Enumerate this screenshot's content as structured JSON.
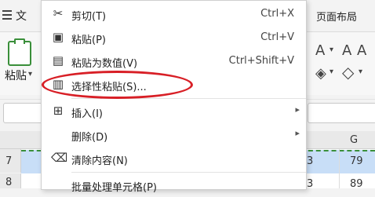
{
  "menubar": {
    "file_label": "文",
    "layout_tab": "页面布局"
  },
  "ribbon": {
    "paste_label": "粘贴",
    "paste_arrow": "▾"
  },
  "grid": {
    "col_g": "G",
    "rows": [
      {
        "num": "7",
        "f": "3",
        "g": "79"
      },
      {
        "num": "8",
        "f": "3",
        "g": "89"
      }
    ]
  },
  "context_menu": {
    "items": [
      {
        "icon": "scissors-icon",
        "label": "剪切(T)",
        "shortcut": "Ctrl+X"
      },
      {
        "icon": "clipboard-icon",
        "label": "粘贴(P)",
        "shortcut": "Ctrl+V"
      },
      {
        "icon": "paste-values-icon",
        "label": "粘贴为数值(V)",
        "shortcut": "Ctrl+Shift+V"
      },
      {
        "icon": "paste-special-icon",
        "label": "选择性粘贴(S)..."
      },
      {
        "icon": "insert-icon",
        "label": "插入(I)",
        "submenu": "▸"
      },
      {
        "icon": "",
        "label": "删除(D)",
        "submenu": "▸"
      },
      {
        "icon": "eraser-icon",
        "label": "清除内容(N)"
      },
      {
        "icon": "",
        "label": "批量处理单元格(P)"
      }
    ]
  },
  "highlight_color": "#d81f26"
}
